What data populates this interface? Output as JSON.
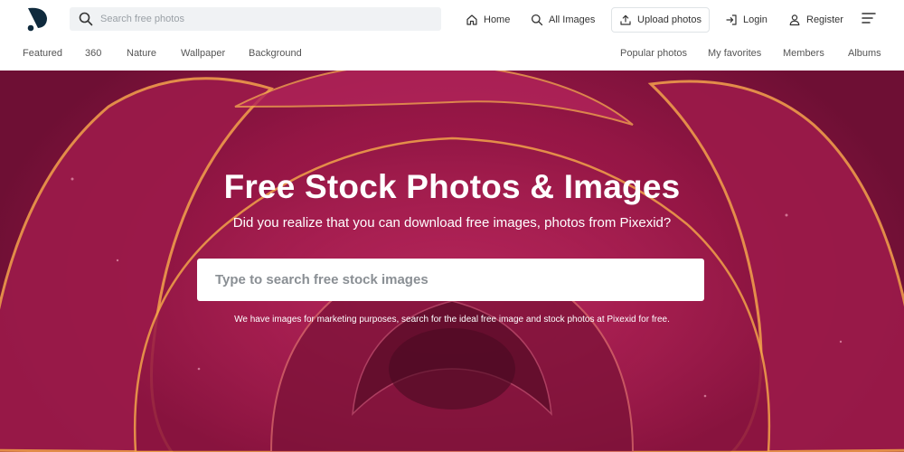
{
  "header": {
    "search_placeholder": "Search free photos",
    "nav": {
      "home": "Home",
      "all_images": "All Images",
      "upload": "Upload photos",
      "login": "Login",
      "register": "Register"
    }
  },
  "subnav": {
    "left": [
      "Featured",
      "360",
      "Nature",
      "Wallpaper",
      "Background"
    ],
    "right": [
      "Popular photos",
      "My favorites",
      "Members",
      "Albums"
    ]
  },
  "hero": {
    "title": "Free Stock Photos & Images",
    "subtitle": "Did you realize that you can download free images, photos from Pixexid?",
    "search_placeholder": "Type to search free stock images",
    "note": "We have images for marketing purposes, search for the ideal free image and stock photos at Pixexid for free."
  },
  "colors": {
    "hero_magenta": "#a81a50",
    "hero_dark": "#5e0d2a",
    "petal_edge": "#f2a24a",
    "logo": "#0f2a3d"
  },
  "icons": [
    "logo-icon",
    "search-icon",
    "home-icon",
    "all-images-search-icon",
    "upload-icon",
    "login-icon",
    "user-icon",
    "menu-icon"
  ]
}
